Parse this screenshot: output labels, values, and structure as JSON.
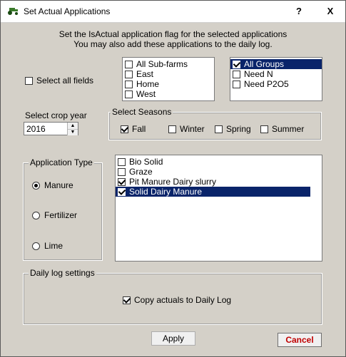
{
  "window": {
    "title": "Set Actual Applications",
    "help": "?",
    "close": "X"
  },
  "intro": {
    "line1": "Set the IsActual application flag for the selected applications",
    "line2": "You may also add these applications to the daily log."
  },
  "select_all_fields": {
    "label": "Select all fields",
    "checked": false
  },
  "farms": [
    {
      "label": "All Sub-farms",
      "checked": false
    },
    {
      "label": "East",
      "checked": false
    },
    {
      "label": "Home",
      "checked": false
    },
    {
      "label": "West",
      "checked": false
    }
  ],
  "groups": [
    {
      "label": "All Groups",
      "checked": true,
      "selected": true
    },
    {
      "label": "Need N",
      "checked": false
    },
    {
      "label": "Need P2O5",
      "checked": false
    }
  ],
  "crop_year": {
    "label": "Select crop year",
    "value": "2016"
  },
  "seasons": {
    "label": "Select Seasons",
    "items": [
      {
        "label": "Fall",
        "checked": true
      },
      {
        "label": "Winter",
        "checked": false
      },
      {
        "label": "Spring",
        "checked": false
      },
      {
        "label": "Summer",
        "checked": false
      }
    ]
  },
  "application_type": {
    "label": "Application Type",
    "options": [
      {
        "label": "Manure",
        "checked": true
      },
      {
        "label": "Fertilizer",
        "checked": false
      },
      {
        "label": "Lime",
        "checked": false
      }
    ]
  },
  "applications": [
    {
      "label": "Bio Solid",
      "checked": false
    },
    {
      "label": "Graze",
      "checked": false
    },
    {
      "label": "Pit Manure Dairy slurry",
      "checked": true
    },
    {
      "label": "Solid Dairy Manure",
      "checked": true,
      "selected": true
    }
  ],
  "daily_log": {
    "label": "Daily log settings",
    "copy_label": "Copy actuals to Daily Log",
    "copy_checked": true
  },
  "buttons": {
    "apply": "Apply",
    "cancel": "Cancel"
  }
}
